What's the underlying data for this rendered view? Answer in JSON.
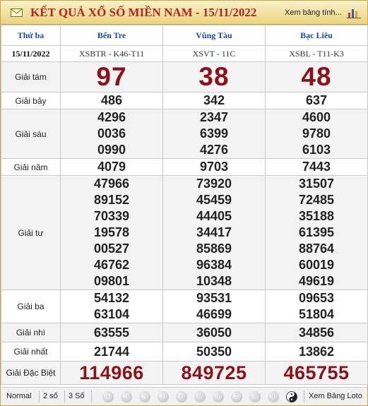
{
  "header": {
    "title": "KẾT QUẢ XỔ SỐ MIỀN NAM - 15/11/2022",
    "link_label": "Xem bảng tính..."
  },
  "table": {
    "day": "Thứ ba",
    "date": "15/11/2022",
    "provinces": [
      {
        "name": "Bến Tre",
        "code": "XSBTR - K46-T11"
      },
      {
        "name": "Vũng Tàu",
        "code": "XSVT - 11C"
      },
      {
        "name": "Bạc Liêu",
        "code": "XSBL - T11-K3"
      }
    ],
    "prizes": [
      {
        "label": "Giải tám",
        "values": [
          [
            "97"
          ],
          [
            "38"
          ],
          [
            "48"
          ]
        ]
      },
      {
        "label": "Giải bảy",
        "values": [
          [
            "486"
          ],
          [
            "342"
          ],
          [
            "637"
          ]
        ]
      },
      {
        "label": "Giải sáu",
        "values": [
          [
            "4296",
            "0036",
            "0990"
          ],
          [
            "2347",
            "6399",
            "4276"
          ],
          [
            "4600",
            "9780",
            "6103"
          ]
        ]
      },
      {
        "label": "Giải năm",
        "values": [
          [
            "4079"
          ],
          [
            "9703"
          ],
          [
            "7443"
          ]
        ]
      },
      {
        "label": "Giải tư",
        "values": [
          [
            "47966",
            "89152",
            "70339",
            "19578",
            "00527",
            "46762",
            "09801"
          ],
          [
            "73920",
            "45459",
            "44405",
            "34417",
            "85869",
            "96384",
            "10348"
          ],
          [
            "31507",
            "72485",
            "35188",
            "61395",
            "88764",
            "60019",
            "49619"
          ]
        ]
      },
      {
        "label": "Giải ba",
        "values": [
          [
            "54132",
            "63104"
          ],
          [
            "93531",
            "46699"
          ],
          [
            "09653",
            "51804"
          ]
        ]
      },
      {
        "label": "Giải nhì",
        "values": [
          [
            "63555"
          ],
          [
            "36050"
          ],
          [
            "34856"
          ]
        ]
      },
      {
        "label": "Giải nhất",
        "values": [
          [
            "21744"
          ],
          [
            "50350"
          ],
          [
            "13862"
          ]
        ]
      },
      {
        "label": "Giải Đặc Biệt",
        "values": [
          [
            "114966"
          ],
          [
            "849725"
          ],
          [
            "465755"
          ]
        ]
      }
    ]
  },
  "footer": {
    "options": [
      "Normal",
      "2 số",
      "3 Số"
    ],
    "digits": [
      "0",
      "1",
      "2",
      "3",
      "4",
      "5",
      "6",
      "7",
      "8",
      "9"
    ],
    "loto_label": "Xem Bảng Loto"
  },
  "colors": {
    "header_bg": "#e9d47f",
    "title": "#c0201d",
    "province": "#1a48a8",
    "prize_highlight": "#8b1218"
  }
}
